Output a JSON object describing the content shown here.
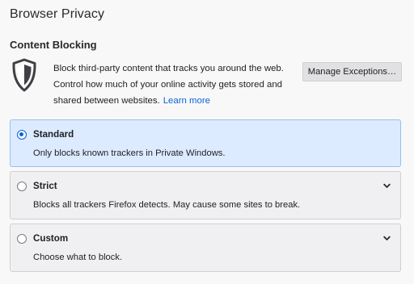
{
  "page": {
    "title": "Browser Privacy"
  },
  "content_blocking": {
    "heading": "Content Blocking",
    "icon": "shield-icon",
    "description": "Block third-party content that tracks you around the web. Control how much of your online activity gets stored and shared between websites.",
    "learn_more_label": "Learn more",
    "manage_exceptions_label": "Manage Exceptions…"
  },
  "options": [
    {
      "id": "standard",
      "label": "Standard",
      "description": "Only blocks known trackers in Private Windows.",
      "selected": true,
      "expandable": false
    },
    {
      "id": "strict",
      "label": "Strict",
      "description": "Blocks all trackers Firefox detects. May cause some sites to break.",
      "selected": false,
      "expandable": true
    },
    {
      "id": "custom",
      "label": "Custom",
      "description": "Choose what to block.",
      "selected": false,
      "expandable": true
    }
  ],
  "colors": {
    "accent": "#0a63d6",
    "selected_background": "#dcebff",
    "selected_border": "#96bff0",
    "panel_background": "#f0f0f2",
    "page_background": "#f8f8f8"
  }
}
